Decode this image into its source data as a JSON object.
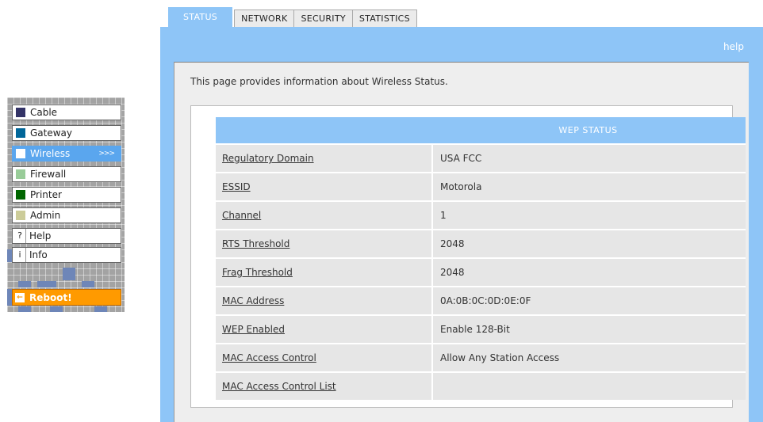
{
  "tabs": [
    "STATUS",
    "NETWORK",
    "SECURITY",
    "STATISTICS"
  ],
  "help_label": "help",
  "intro_text": "This page provides information about Wireless Status.",
  "nav": {
    "items": [
      {
        "label": "Cable",
        "color": "#333366"
      },
      {
        "label": "Gateway",
        "color": "#006699"
      },
      {
        "label": "Wireless",
        "color": "#ffffff",
        "active": true,
        "arrows": ">>>"
      },
      {
        "label": "Firewall",
        "color": "#99cc99"
      },
      {
        "label": "Printer",
        "color": "#006600"
      },
      {
        "label": "Admin",
        "color": "#cccc99"
      },
      {
        "label": "Help",
        "glyph": "?"
      },
      {
        "label": "Info",
        "glyph": "i"
      }
    ],
    "reboot_label": "Reboot!"
  },
  "wep_table": {
    "header": "WEP STATUS",
    "rows": [
      {
        "label": "Regulatory Domain",
        "value": "USA FCC"
      },
      {
        "label": "ESSID",
        "value": "Motorola"
      },
      {
        "label": "Channel",
        "value": "1"
      },
      {
        "label": "RTS Threshold",
        "value": "2048"
      },
      {
        "label": "Frag Threshold",
        "value": "2048"
      },
      {
        "label": "MAC Address",
        "value": "0A:0B:0C:0D:0E:0F"
      },
      {
        "label": "WEP Enabled",
        "value": "Enable 128-Bit"
      },
      {
        "label": "MAC Access Control",
        "value": "Allow Any Station Access"
      },
      {
        "label": "MAC Access Control List",
        "value": ""
      }
    ]
  },
  "colors": {
    "accent_blue": "#8ec5f7",
    "active_nav": "#5aa6ee",
    "reboot_orange": "#ff9a00"
  }
}
